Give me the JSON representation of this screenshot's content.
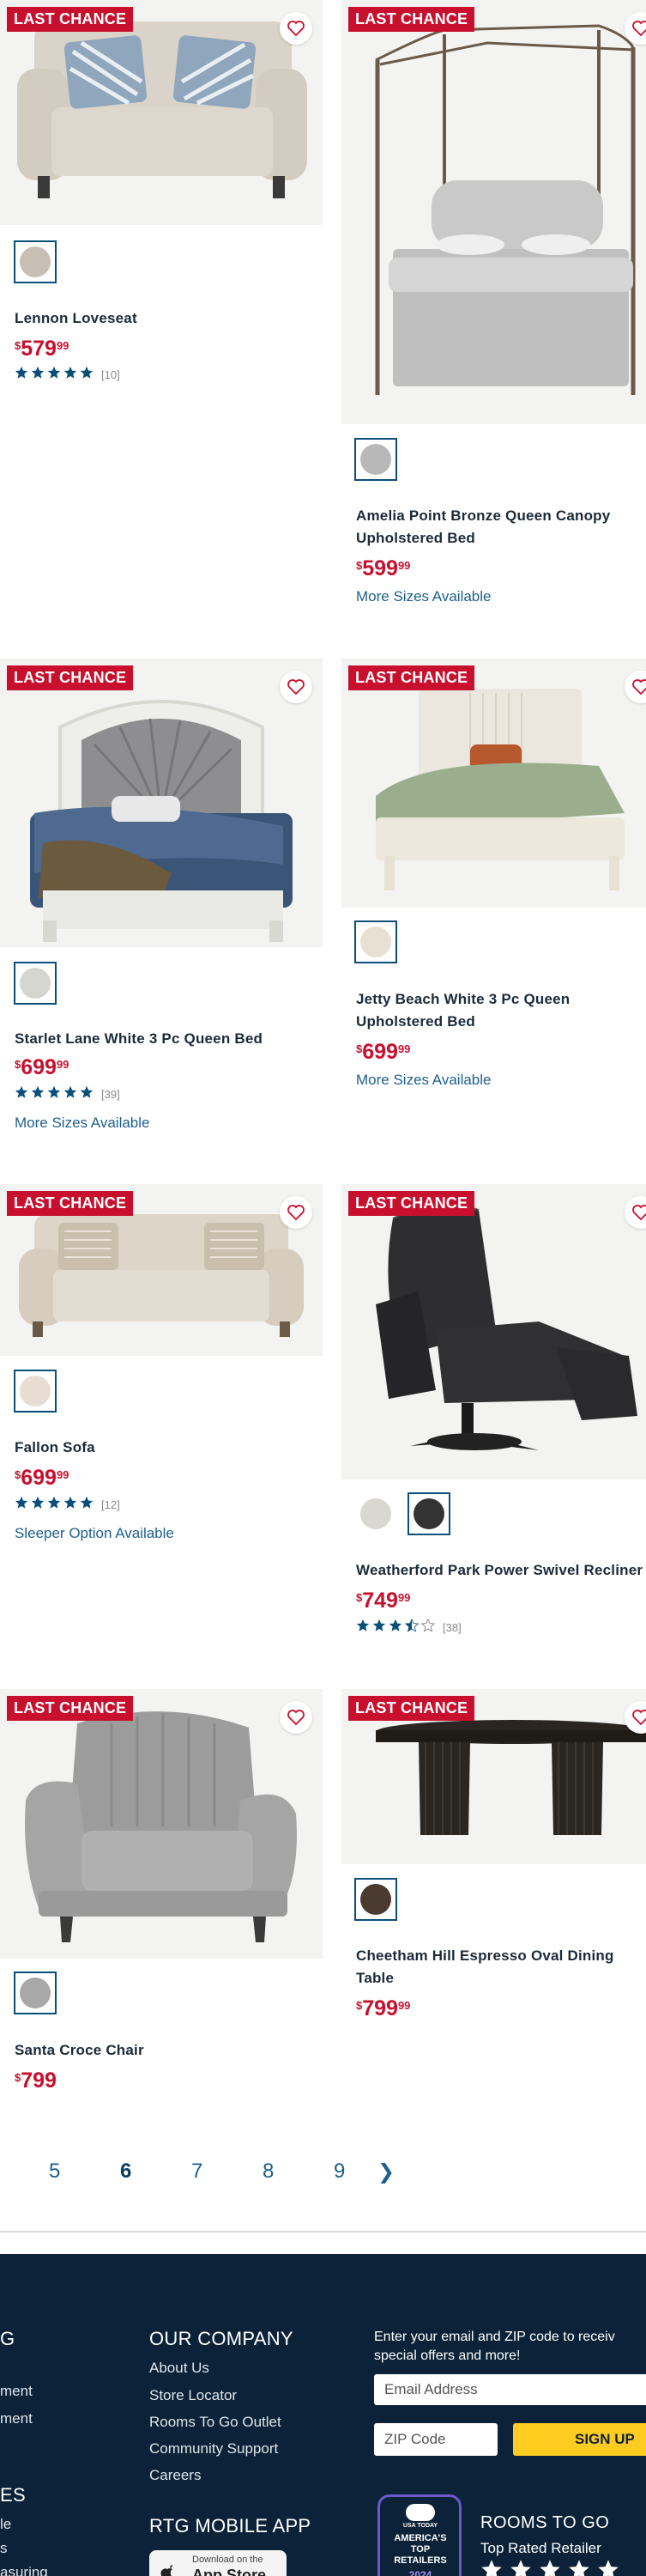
{
  "badge_text": "LAST CHANCE",
  "products": [
    {
      "id": "lennon",
      "name_lines": [
        "Lennon Loveseat"
      ],
      "price": {
        "currency": "$",
        "dollars": "579",
        "cents": "99"
      },
      "rating": 5,
      "reviews": "[10]",
      "extra": "",
      "swatch_colors": [
        "#c8bfb4"
      ]
    },
    {
      "id": "amelia",
      "name_lines": [
        "Amelia Point Bronze Queen Canopy",
        "Upholstered Bed"
      ],
      "price": {
        "currency": "$",
        "dollars": "599",
        "cents": "99"
      },
      "rating": null,
      "reviews": "",
      "extra": "More Sizes Available",
      "swatch_colors": [
        "#b8b8b8"
      ]
    },
    {
      "id": "starlet",
      "name_lines": [
        "Starlet Lane White 3 Pc Queen Bed"
      ],
      "price": {
        "currency": "$",
        "dollars": "699",
        "cents": "99"
      },
      "rating": 5,
      "reviews": "[39]",
      "extra": "More Sizes Available",
      "swatch_colors": [
        "#d6d6d0"
      ]
    },
    {
      "id": "jetty",
      "name_lines": [
        "Jetty Beach White 3 Pc Queen",
        "Upholstered Bed"
      ],
      "price": {
        "currency": "$",
        "dollars": "699",
        "cents": "99"
      },
      "rating": null,
      "reviews": "",
      "extra": "More Sizes Available",
      "swatch_colors": [
        "#e8e0d2"
      ]
    },
    {
      "id": "fallon",
      "name_lines": [
        "Fallon Sofa"
      ],
      "price": {
        "currency": "$",
        "dollars": "699",
        "cents": "99"
      },
      "rating": 5,
      "reviews": "[12]",
      "extra": "Sleeper Option Available",
      "swatch_colors": [
        "#e8ddd2"
      ]
    },
    {
      "id": "weatherford",
      "name_lines": [
        "Weatherford Park Power Swivel Recliner"
      ],
      "price": {
        "currency": "$",
        "dollars": "749",
        "cents": "99"
      },
      "rating": 3.5,
      "reviews": "[38]",
      "extra": "",
      "swatch_colors": [
        "#d8d8d0",
        "#333333"
      ]
    },
    {
      "id": "santa",
      "name_lines": [
        "Santa Croce Chair"
      ],
      "price": {
        "currency": "$",
        "dollars": "799",
        "cents": ""
      },
      "rating": null,
      "reviews": "",
      "extra": "",
      "swatch_colors": [
        "#a8a8a8"
      ]
    },
    {
      "id": "cheetham",
      "name_lines": [
        "Cheetham Hill Espresso Oval Dining",
        "Table"
      ],
      "price": {
        "currency": "$",
        "dollars": "799",
        "cents": "99"
      },
      "rating": null,
      "reviews": "",
      "extra": "",
      "swatch_colors": [
        "#4a3a30"
      ]
    }
  ],
  "pagination": {
    "pages": [
      "5",
      "6",
      "7",
      "8",
      "9"
    ],
    "current": "6",
    "next": "❯"
  },
  "footer": {
    "col1_head": "G",
    "col1_links": [
      "ment",
      "ment"
    ],
    "col1_head2": "ES",
    "col1_links2": [
      "le",
      "s",
      "asuring"
    ],
    "company_head": "OUR COMPANY",
    "company_links": [
      "About Us",
      "Store Locator",
      "Rooms To Go Outlet",
      "Community Support",
      "Careers"
    ],
    "app_head": "RTG MOBILE APP",
    "app_small": "Download on the",
    "app_big": "App Store",
    "signup_text_1": "Enter your email and ZIP code to receiv",
    "signup_text_2": "special offers and more!",
    "email_placeholder": "Email Address",
    "zip_placeholder": "ZIP Code",
    "signup_button": "SIGN UP",
    "usa_today_top": "USA TODAY",
    "usa_today_line1": "AMERICA'S",
    "usa_today_line2": "TOP",
    "usa_today_line3": "RETAILERS",
    "usa_today_year": "2024",
    "award_head": "ROOMS TO GO",
    "award_sub": "Top Rated Retailer"
  },
  "colors": {
    "accent_red": "#c8102e",
    "link_blue": "#1e5f8c",
    "footer_navy": "#0b2238",
    "signup_yellow": "#ffcc1f",
    "star_blue": "#0a4e7a"
  }
}
